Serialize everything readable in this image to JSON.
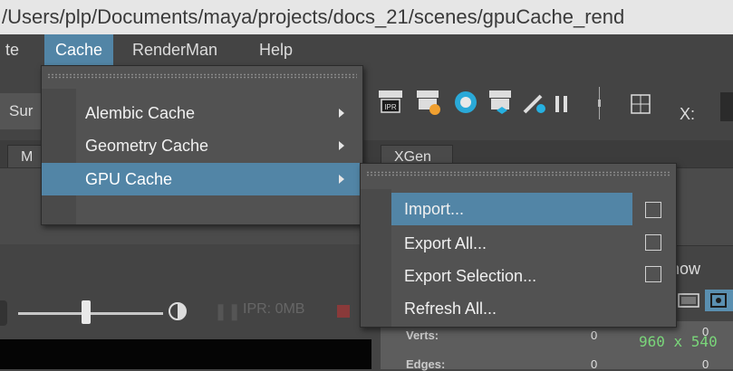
{
  "window": {
    "title": "/Users/plp/Documents/maya/projects/docs_21/scenes/gpuCache_rend"
  },
  "menubar": {
    "items": [
      {
        "label": "te"
      },
      {
        "label": "Cache"
      },
      {
        "label": "RenderMan"
      },
      {
        "label": "Help"
      }
    ]
  },
  "toolbar": {
    "shelf_label": "Sur",
    "x_label": "X:",
    "ipr_badge": "IPR"
  },
  "tabs": [
    {
      "label": "M"
    },
    {
      "label": "XGen"
    }
  ],
  "renderbar": {
    "ipr_status": "IPR: 0MB"
  },
  "panel": {
    "show_label": "how"
  },
  "stats": {
    "rows": [
      {
        "label": "Verts:",
        "col1": "0",
        "col2": "0"
      },
      {
        "label": "Edges:",
        "col1": "0",
        "col2": "0"
      }
    ],
    "resolution": "960 x 540"
  },
  "cache_menu": {
    "items": [
      {
        "label": "Alembic Cache"
      },
      {
        "label": "Geometry Cache"
      },
      {
        "label": "GPU Cache"
      }
    ]
  },
  "gpu_cache_submenu": {
    "items": [
      {
        "label": "Import..."
      },
      {
        "label": "Export All..."
      },
      {
        "label": "Export Selection..."
      },
      {
        "label": "Refresh All..."
      }
    ]
  },
  "colors": {
    "highlight": "#5285a6",
    "menu_bg": "#525252",
    "app_bg": "#444444"
  }
}
